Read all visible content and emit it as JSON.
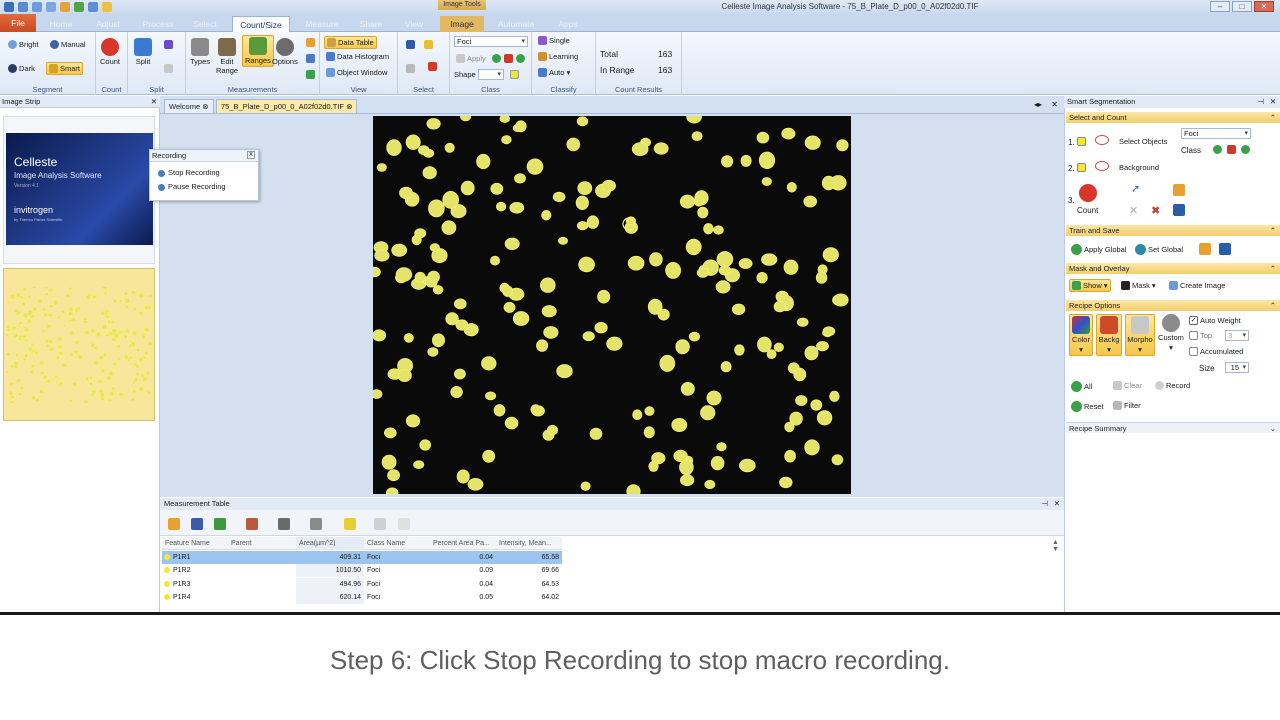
{
  "window": {
    "title": "Celleste Image Analysis Software - 75_B_Plate_D_p00_0_A02f02d0.TIF",
    "context_tab_group": "Image Tools"
  },
  "ribbon_tabs": [
    "File",
    "Home",
    "Adjust",
    "Process",
    "Select",
    "Count/Size",
    "Measure",
    "Share",
    "View",
    "Image",
    "Automate",
    "Apps"
  ],
  "ribbon": {
    "segment": {
      "bright": "Bright",
      "manual": "Manual",
      "dark": "Dark",
      "smart": "Smart",
      "label": "Segment"
    },
    "count": {
      "count": "Count",
      "label": "Count"
    },
    "split": {
      "split": "Split",
      "label": "Split"
    },
    "measurements": {
      "types": "Types",
      "edit_range": "Edit Range",
      "ranges": "Ranges",
      "options": "Options",
      "label": "Measurements"
    },
    "view": {
      "data_table": "Data Table",
      "data_histogram": "Data Histogram",
      "object_window": "Object Window",
      "label": "View"
    },
    "select": {
      "label": "Select"
    },
    "class": {
      "combo": "Foci",
      "apply": "Apply",
      "shape": "Shape",
      "label": "Class"
    },
    "classify": {
      "single": "Single",
      "learning": "Learning",
      "auto": "Auto",
      "label": "Classify"
    },
    "count_results": {
      "total_label": "Total",
      "total_value": "163",
      "in_range_label": "In Range",
      "in_range_value": "163",
      "label": "Count Results"
    }
  },
  "image_strip": {
    "title": "Image Strip",
    "splash_title": "Celleste",
    "splash_subtitle": "Image Analysis Software",
    "splash_version": "Version 4.1",
    "splash_brand": "invitrogen",
    "splash_brand_sub": "by Thermo Fisher Scientific"
  },
  "doc_tabs": [
    "Welcome",
    "75_B_Plate_D_p00_0_A02f02d0.TIF"
  ],
  "recording": {
    "title": "Recording",
    "stop": "Stop Recording",
    "pause": "Pause Recording"
  },
  "measurement_table": {
    "title": "Measurement Table",
    "columns": [
      "Feature Name",
      "Parent",
      "Area(µm^2)",
      "Class Name",
      "Percent Area Pa...",
      "Intensity, Mean..."
    ],
    "rows": [
      [
        "P1R1",
        "",
        "409.31",
        "Foci",
        "0.04",
        "65.58"
      ],
      [
        "P1R2",
        "",
        "1010.50",
        "Foci",
        "0.09",
        "69.66"
      ],
      [
        "P1R3",
        "",
        "494.96",
        "Foci",
        "0.04",
        "64.53"
      ],
      [
        "P1R4",
        "",
        "620.14",
        "Foci",
        "0.05",
        "64.02"
      ]
    ]
  },
  "smart_segmentation": {
    "title": "Smart Segmentation",
    "select_and_count": "Select and Count",
    "step1": "1.",
    "select_objects": "Select Objects",
    "class_combo": "Foci",
    "class_label": "Class",
    "step2": "2.",
    "background": "Background",
    "step3": "3.",
    "count": "Count",
    "train_and_save": "Train and Save",
    "apply_global": "Apply Global",
    "set_global": "Set Global",
    "mask_and_overlay": "Mask and Overlay",
    "show": "Show",
    "mask": "Mask",
    "create_image": "Create Image",
    "recipe_options": "Recipe Options",
    "color": "Color",
    "backg": "Backg",
    "morpho": "Morpho",
    "custom": "Custom",
    "auto_weight": "Auto Weight",
    "top": "Top",
    "top_value": "3",
    "accumulated": "Accumulated",
    "size": "Size",
    "size_value": "15",
    "all": "All",
    "clear": "Clear",
    "record": "Record",
    "reset": "Reset",
    "filter": "Filter",
    "recipe_summary": "Recipe Summary"
  },
  "caption": "Step 6: Click Stop Recording to stop macro recording.",
  "colors": {
    "accent": "#f6c64a",
    "file_tab": "#d4572a",
    "blob": "#e4e36a"
  }
}
